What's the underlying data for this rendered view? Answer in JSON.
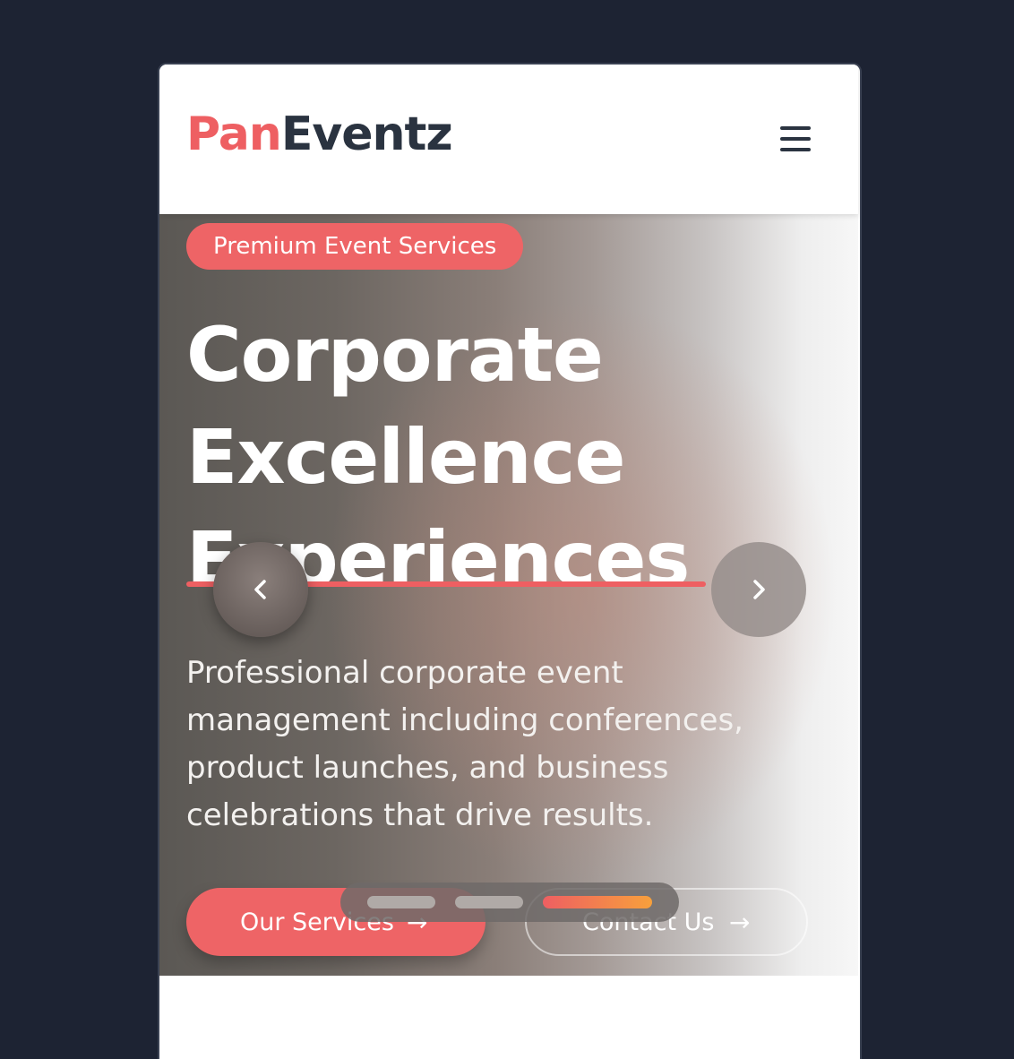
{
  "header": {
    "logo_part1": "Pan",
    "logo_part2": "Eventz",
    "menu_icon": "hamburger-menu-icon"
  },
  "hero": {
    "badge": "Premium Event Services",
    "headline_lines": [
      "Corporate",
      "Excellence",
      "Experiences"
    ],
    "description": "Professional corporate event management including conferences, product launches, and business celebrations that drive results.",
    "primary_button": "Our Services",
    "secondary_button": "Contact Us",
    "prev_icon": "chevron-left-icon",
    "next_icon": "chevron-right-icon",
    "arrow_icon": "arrow-right-icon",
    "slides_total": 3,
    "active_slide": 3
  },
  "colors": {
    "accent": "#ee5f62",
    "dark_text": "#2a3340",
    "page_background": "#1d2333",
    "indicator_gradient_end": "#f7a03c"
  }
}
